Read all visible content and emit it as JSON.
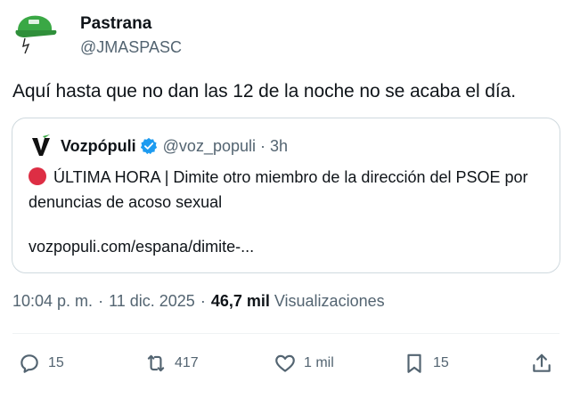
{
  "author": {
    "name": "Pastrana",
    "handle": "@JMASPASC",
    "avatar_icon": "green-cap-icon"
  },
  "tweet": {
    "text": "Aquí hasta que no dan las 12 de la noche no se acaba el día."
  },
  "quote": {
    "name": "Vozpópuli",
    "handle": "@voz_populi",
    "separator": "·",
    "time": "3h",
    "logo_icon": "vozpopuli-v-logo-icon",
    "verified_icon": "verified-badge-icon",
    "text": "ÚLTIMA HORA | Dimite otro miembro de la dirección del PSOE por denuncias de acoso sexual",
    "link": "vozpopuli.com/espana/dimite-..."
  },
  "meta": {
    "time": "10:04 p. m.",
    "sep1": "·",
    "date": "11 dic. 2025",
    "sep2": "·",
    "views_count": "46,7 mil",
    "views_label": "Visualizaciones"
  },
  "actions": {
    "replies": "15",
    "reposts": "417",
    "likes": "1 mil",
    "bookmarks": "15"
  },
  "colors": {
    "text": "#0f1419",
    "secondary": "#536471",
    "border": "#cfd9de",
    "verified": "#1d9bf0",
    "red_dot": "#dd2e44",
    "brand_green": "#3aa845"
  }
}
